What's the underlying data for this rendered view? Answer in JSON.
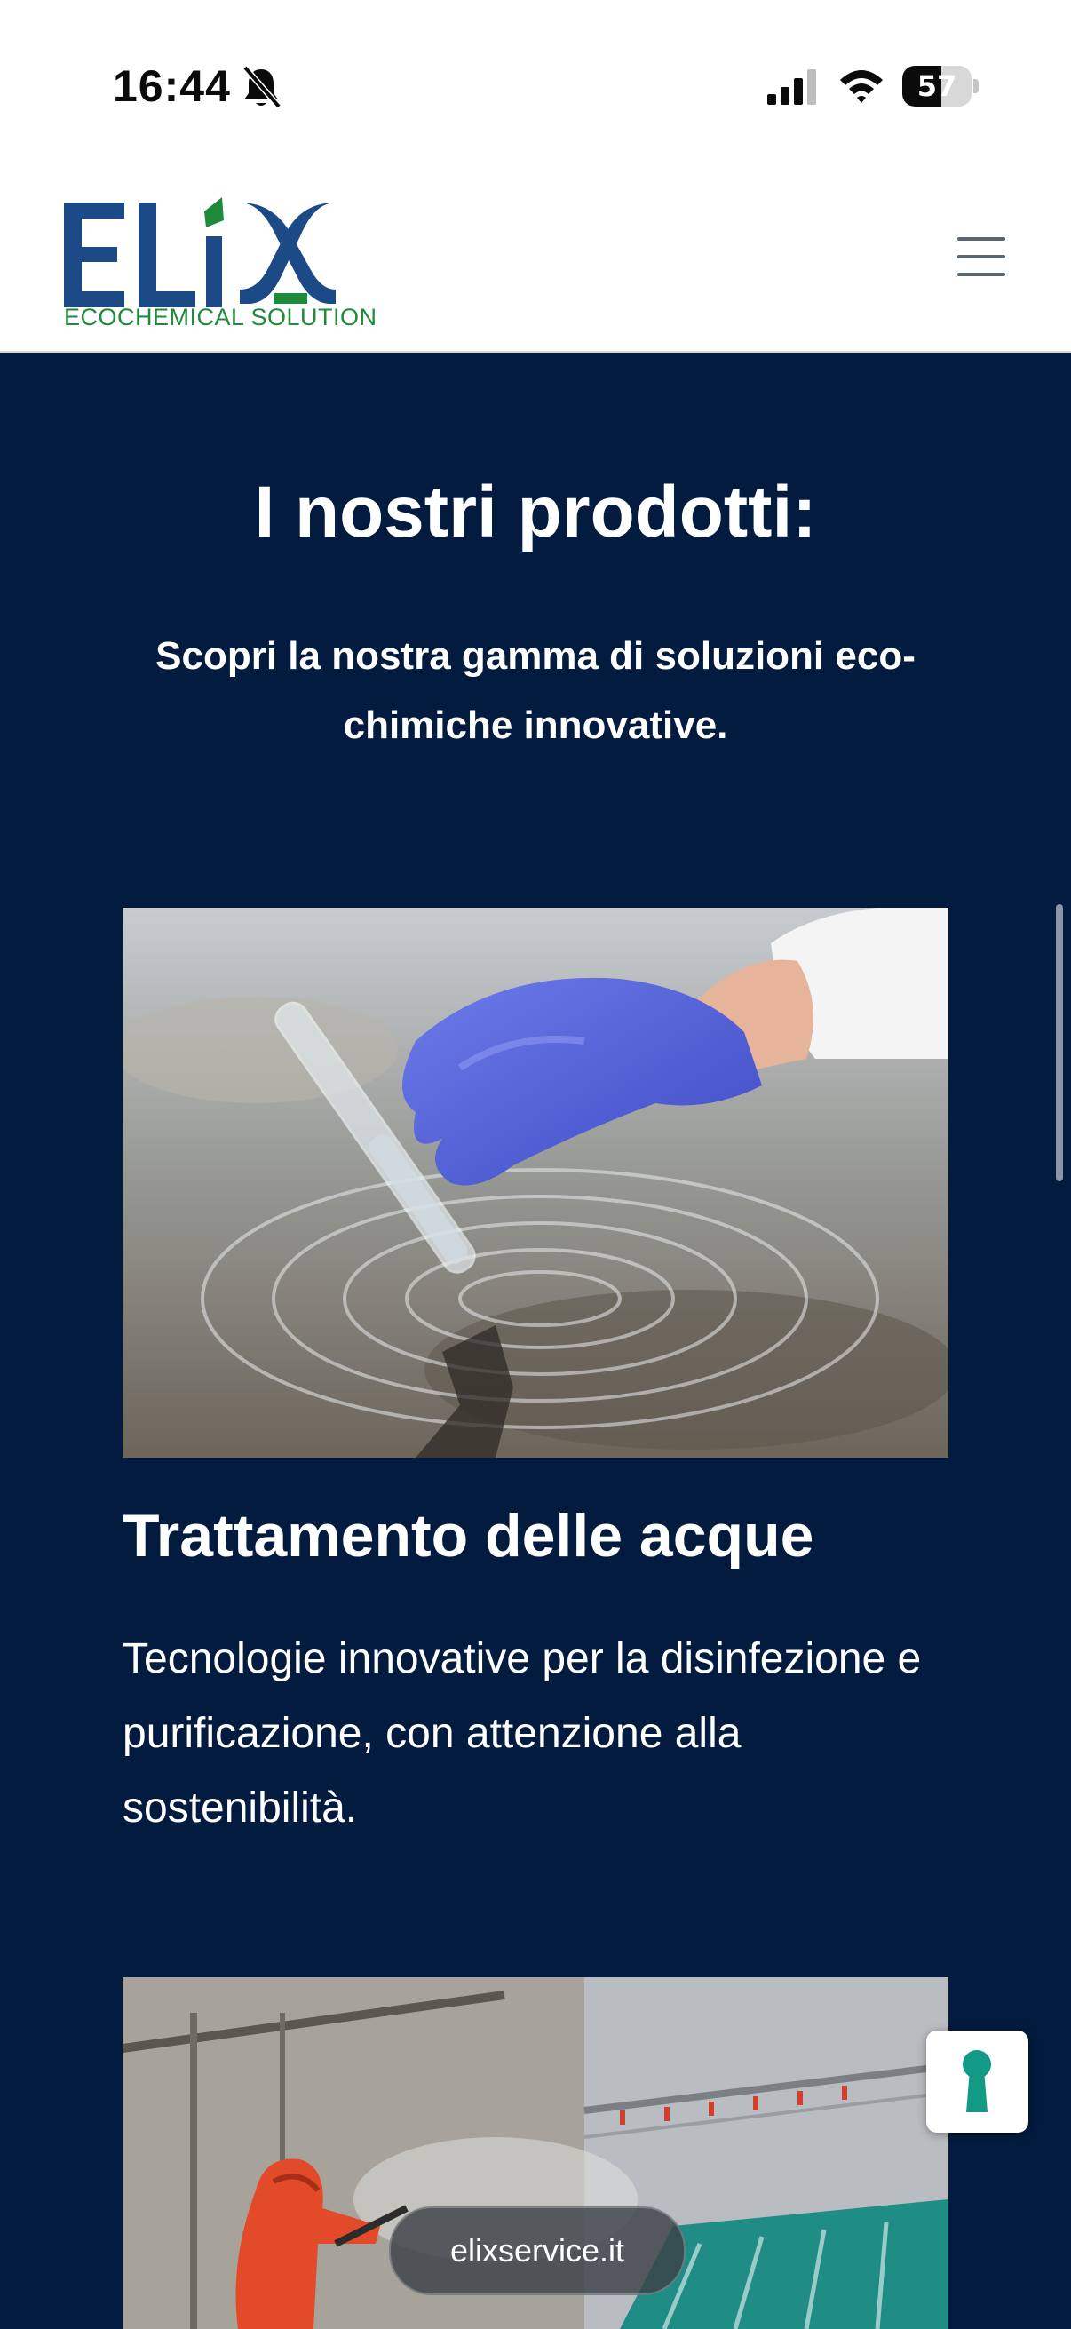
{
  "status_bar": {
    "time": "16:44",
    "battery_level": "57"
  },
  "header": {
    "logo_text": "ELIX",
    "logo_tagline": "ECOCHEMICAL SOLUTION",
    "menu_icon": "hamburger-menu-icon"
  },
  "section": {
    "title": "I nostri prodotti:",
    "subtitle": "Scopri la nostra gamma di soluzioni eco-chimiche innovative."
  },
  "products": [
    {
      "title": "Trattamento delle acque",
      "description": "Tecnologie innovative per la disinfezione e purificazione, con attenzione alla sostenibilità."
    }
  ],
  "browser": {
    "url": "elixservice.it"
  },
  "colors": {
    "background": "#031b3e",
    "logo_blue": "#1b4a86",
    "logo_green": "#1f8a3a",
    "accent_teal": "#139a87"
  }
}
